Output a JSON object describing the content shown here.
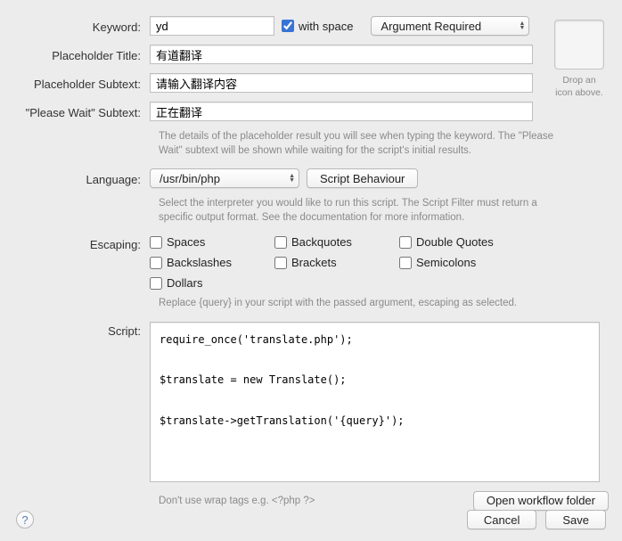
{
  "labels": {
    "keyword": "Keyword:",
    "placeholder_title": "Placeholder Title:",
    "placeholder_subtext": "Placeholder Subtext:",
    "please_wait_subtext": "\"Please Wait\" Subtext:",
    "language": "Language:",
    "escaping": "Escaping:",
    "script": "Script:"
  },
  "keyword": {
    "value": "yd",
    "with_space_label": "with space",
    "with_space_checked": true,
    "argument": "Argument Required"
  },
  "placeholder_title": "有道翻译",
  "placeholder_subtext": "请输入翻译内容",
  "please_wait_subtext": "正在翻译",
  "details_hint": "The details of the placeholder result you will see when typing the keyword. The \"Please Wait\" subtext will be shown while waiting for the script's initial results.",
  "language": {
    "value": "/usr/bin/php",
    "behaviour_button": "Script Behaviour"
  },
  "language_hint": "Select the interpreter you would like to run this script. The Script Filter must return a specific output format. See the documentation for more information.",
  "escaping": {
    "options": {
      "spaces": "Spaces",
      "backquotes": "Backquotes",
      "double_quotes": "Double Quotes",
      "backslashes": "Backslashes",
      "brackets": "Brackets",
      "semicolons": "Semicolons",
      "dollars": "Dollars"
    },
    "hint": "Replace {query} in your script with the passed argument, escaping as selected."
  },
  "script": {
    "value": "require_once('translate.php');\n\n$translate = new Translate();\n\n$translate->getTranslation('{query}');",
    "tip": "Don't use wrap tags e.g. <?php ?>",
    "open_folder": "Open workflow folder"
  },
  "icon_drop": {
    "line1": "Drop an",
    "line2": "icon above."
  },
  "buttons": {
    "cancel": "Cancel",
    "save": "Save"
  },
  "help_glyph": "?"
}
